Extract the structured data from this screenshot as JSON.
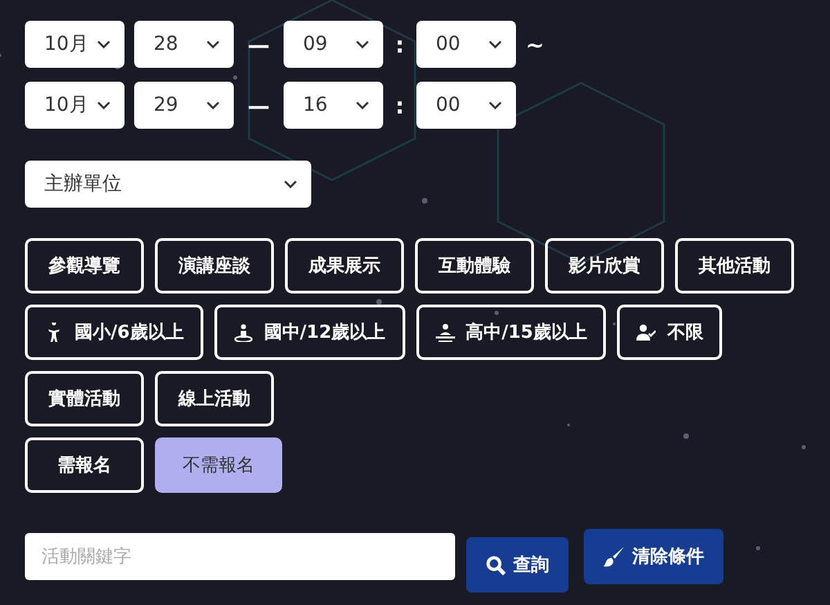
{
  "date_range": [
    {
      "month": "10月",
      "day": "28",
      "hour": "09",
      "minute": "00",
      "separator": "—",
      "colon": ":",
      "tail": "~"
    },
    {
      "month": "10月",
      "day": "29",
      "hour": "16",
      "minute": "00",
      "separator": "—",
      "colon": ":"
    }
  ],
  "organizer_select": {
    "value": "主辦單位"
  },
  "filter_groups": [
    {
      "kind": "plain",
      "options": [
        {
          "label": "參觀導覽",
          "selected": false
        },
        {
          "label": "演講座談",
          "selected": false
        },
        {
          "label": "成果展示",
          "selected": false
        },
        {
          "label": "互動體驗",
          "selected": false
        },
        {
          "label": "影片欣賞",
          "selected": false
        },
        {
          "label": "其他活動",
          "selected": false
        }
      ]
    },
    {
      "kind": "icon",
      "options": [
        {
          "label": "國小/6歲以上",
          "selected": false
        },
        {
          "label": "國中/12歲以上",
          "selected": false
        },
        {
          "label": "高中/15歲以上",
          "selected": false
        },
        {
          "label": "不限",
          "selected": false
        }
      ]
    },
    {
      "kind": "plain",
      "options": [
        {
          "label": "實體活動",
          "selected": false
        },
        {
          "label": "線上活動",
          "selected": false
        }
      ]
    },
    {
      "kind": "plain",
      "options": [
        {
          "label": "需報名",
          "selected": false
        },
        {
          "label": "不需報名",
          "selected": true
        }
      ]
    }
  ],
  "keyword_field": {
    "placeholder": "活動關鍵字"
  },
  "buttons": [
    {
      "kind": "search",
      "label": "查詢"
    },
    {
      "kind": "clear",
      "label": "清除條件"
    }
  ]
}
